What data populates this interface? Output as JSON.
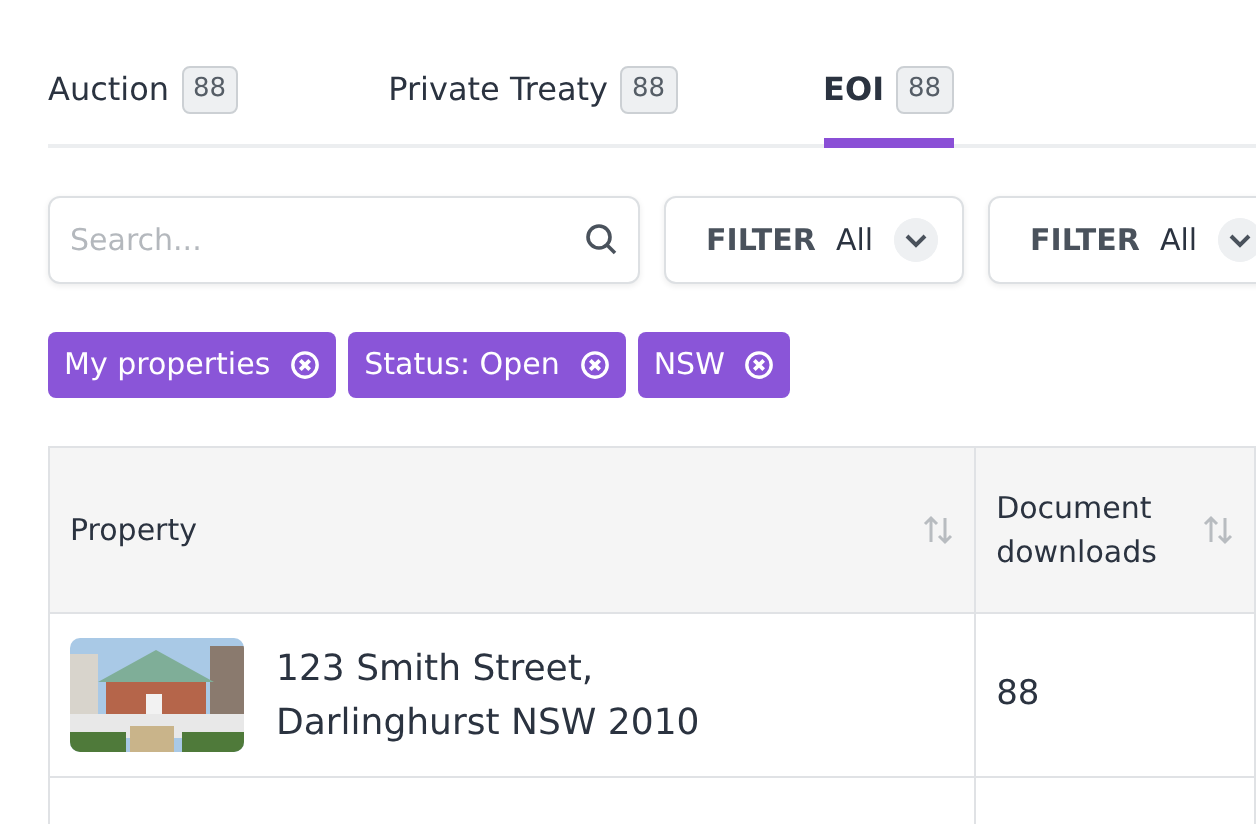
{
  "tabs": [
    {
      "label": "Auction",
      "count": "88",
      "selected": false
    },
    {
      "label": "Private Treaty",
      "count": "88",
      "selected": false
    },
    {
      "label": "EOI",
      "count": "88",
      "selected": true
    }
  ],
  "search": {
    "placeholder": "Search..."
  },
  "filters": [
    {
      "label": "FILTER",
      "value": "All"
    },
    {
      "label": "FILTER",
      "value": "All"
    }
  ],
  "chips": [
    "My properties",
    "Status: Open",
    "NSW"
  ],
  "table": {
    "columns": [
      "Property",
      "Document downloads"
    ],
    "rows": [
      {
        "property": "123 Smith Street,\nDarlinghurst NSW 2010",
        "downloads": "88"
      }
    ]
  }
}
